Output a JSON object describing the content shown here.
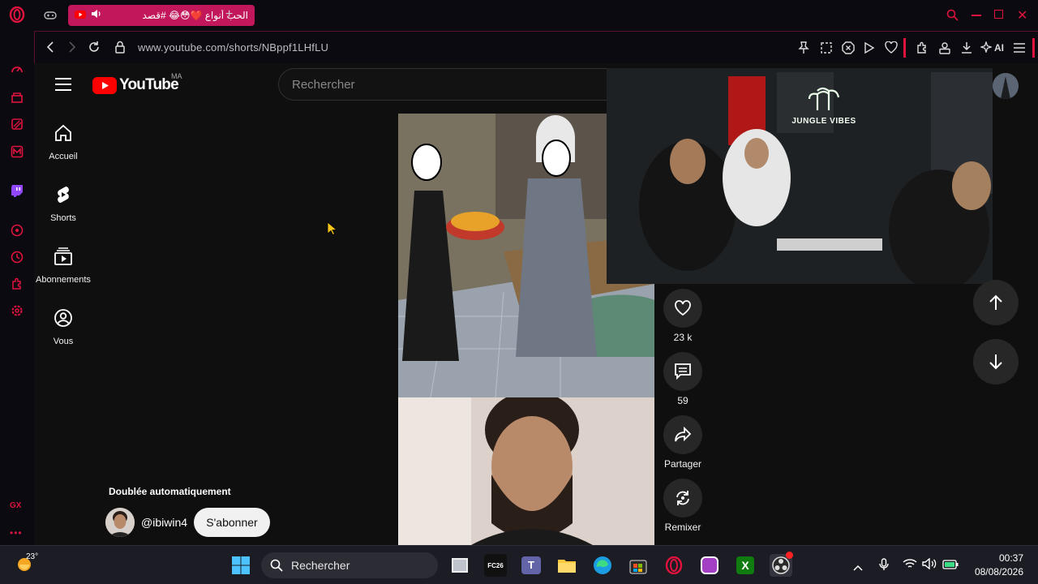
{
  "browser": {
    "tab_title": "الحب أنواع ❤️😳😂 #قصد",
    "url": "www.youtube.com/shorts/NBppf1LHfLU",
    "ai_label": "AI"
  },
  "youtube": {
    "logo_text": "YouTube",
    "country_code": "MA",
    "search_placeholder": "Rechercher",
    "nav": [
      {
        "label": "Accueil"
      },
      {
        "label": "Shorts"
      },
      {
        "label": "Abonnements"
      },
      {
        "label": "Vous"
      }
    ],
    "overlay_sign": "JUNGLE VIBES",
    "dubbed_label": "Doublée automatiquement",
    "channel_handle": "@ibiwin4",
    "subscribe_label": "S'abonner",
    "actions": {
      "likes": "23 k",
      "comments": "59",
      "share": "Partager",
      "remix": "Remixer"
    }
  },
  "gx_sidebar": {
    "gx_label": "GX"
  },
  "taskbar": {
    "weather_temp": "23°",
    "search_placeholder": "Rechercher",
    "time": "00:37",
    "date": "08/08/2026"
  },
  "colors": {
    "opera_red": "#e0133e",
    "tab_pink": "#c2185b",
    "yt_red": "#ff0000"
  }
}
